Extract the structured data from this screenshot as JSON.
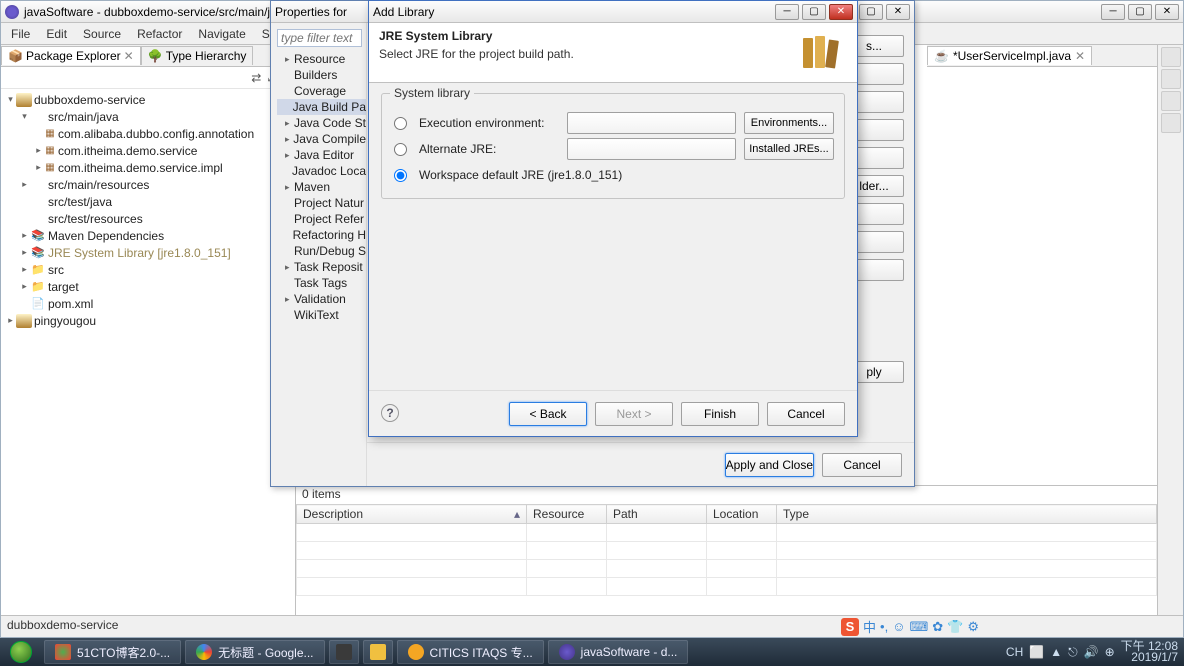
{
  "mainWindow": {
    "title": "javaSoftware - dubboxdemo-service/src/main/jav",
    "menu": [
      "File",
      "Edit",
      "Source",
      "Refactor",
      "Navigate",
      "Search"
    ],
    "editorTab": "*UserServiceImpl.java",
    "status": "dubboxdemo-service"
  },
  "packageExplorer": {
    "tabs": [
      "Package Explorer",
      "Type Hierarchy"
    ],
    "tree": [
      {
        "lvl": 0,
        "tw": "▾",
        "icon": "project",
        "label": "dubboxdemo-service"
      },
      {
        "lvl": 1,
        "tw": "▾",
        "icon": "pkg-folder",
        "label": "src/main/java"
      },
      {
        "lvl": 2,
        "tw": "",
        "icon": "pkg",
        "label": "com.alibaba.dubbo.config.annotation"
      },
      {
        "lvl": 2,
        "tw": "▸",
        "icon": "pkg",
        "label": "com.itheima.demo.service"
      },
      {
        "lvl": 2,
        "tw": "▸",
        "icon": "pkg",
        "label": "com.itheima.demo.service.impl"
      },
      {
        "lvl": 1,
        "tw": "▸",
        "icon": "pkg-folder",
        "label": "src/main/resources"
      },
      {
        "lvl": 1,
        "tw": "",
        "icon": "pkg-folder",
        "label": "src/test/java"
      },
      {
        "lvl": 1,
        "tw": "",
        "icon": "pkg-folder",
        "label": "src/test/resources"
      },
      {
        "lvl": 1,
        "tw": "▸",
        "icon": "lib",
        "label": "Maven Dependencies"
      },
      {
        "lvl": 1,
        "tw": "▸",
        "icon": "lib",
        "label": "JRE System Library [jre1.8.0_151]",
        "cls": "lib-text"
      },
      {
        "lvl": 1,
        "tw": "▸",
        "icon": "folder",
        "label": "src"
      },
      {
        "lvl": 1,
        "tw": "▸",
        "icon": "folder",
        "label": "target"
      },
      {
        "lvl": 1,
        "tw": "",
        "icon": "xml",
        "label": "pom.xml"
      },
      {
        "lvl": 0,
        "tw": "▸",
        "icon": "project",
        "label": "pingyougou"
      }
    ]
  },
  "propsDialog": {
    "title": "Properties for",
    "filterPlaceholder": "type filter text",
    "items": [
      {
        "tw": "▸",
        "label": "Resource"
      },
      {
        "tw": "",
        "label": "Builders"
      },
      {
        "tw": "",
        "label": "Coverage"
      },
      {
        "tw": "",
        "label": "Java Build Pa",
        "sel": true
      },
      {
        "tw": "▸",
        "label": "Java Code St"
      },
      {
        "tw": "▸",
        "label": "Java Compile"
      },
      {
        "tw": "▸",
        "label": "Java Editor"
      },
      {
        "tw": "",
        "label": "Javadoc Loca"
      },
      {
        "tw": "▸",
        "label": "Maven"
      },
      {
        "tw": "",
        "label": "Project Natur"
      },
      {
        "tw": "",
        "label": "Project Refer"
      },
      {
        "tw": "",
        "label": "Refactoring H"
      },
      {
        "tw": "",
        "label": "Run/Debug S"
      },
      {
        "tw": "▸",
        "label": "Task Reposit"
      },
      {
        "tw": "",
        "label": "Task Tags"
      },
      {
        "tw": "▸",
        "label": "Validation"
      },
      {
        "tw": "",
        "label": "WikiText"
      }
    ],
    "sideButtons": [
      "s...",
      "",
      "",
      "",
      "",
      "lder...",
      "",
      "",
      ""
    ],
    "applyLabel": "ply",
    "footer": {
      "apply": "Apply and Close",
      "cancel": "Cancel"
    }
  },
  "addLibDialog": {
    "title": "Add Library",
    "heading": "JRE System Library",
    "desc": "Select JRE for the project build path.",
    "groupLegend": "System library",
    "radios": {
      "exec": "Execution environment:",
      "alt": "Alternate JRE:",
      "ws": "Workspace default JRE (jre1.8.0_151)"
    },
    "envBtn": "Environments...",
    "jreBtn": "Installed JREs...",
    "footer": {
      "back": "< Back",
      "next": "Next >",
      "finish": "Finish",
      "cancel": "Cancel"
    }
  },
  "problems": {
    "count": "0 items",
    "columns": [
      "Description",
      "Resource",
      "Path",
      "Location",
      "Type"
    ]
  },
  "taskbar": {
    "items": [
      "51CTO博客2.0-...",
      "无标题 - Google...",
      "",
      "",
      "",
      "CITICS ITAQS 专...",
      "javaSoftware - d..."
    ],
    "tray": {
      "ime": "CH",
      "time": "下午 12:08",
      "date": "2019/1/7"
    }
  }
}
